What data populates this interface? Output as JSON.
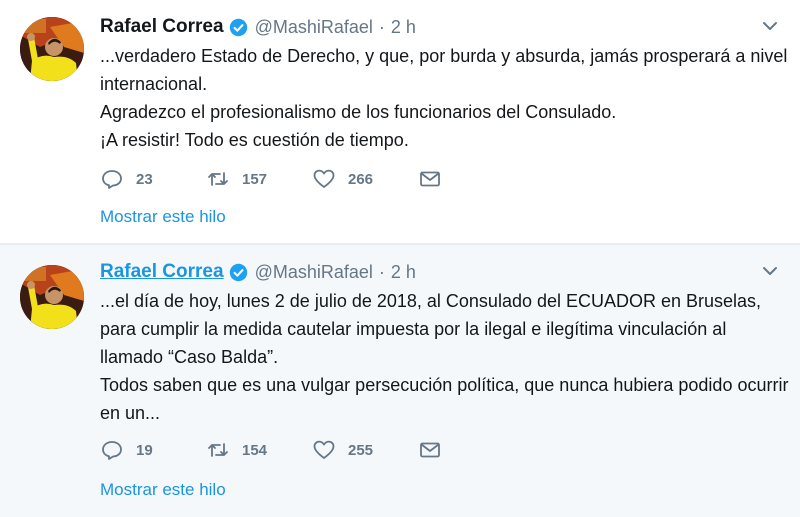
{
  "colors": {
    "link": "#1b95e0",
    "muted": "#657786",
    "text": "#14171a",
    "verified": "#1da1f2",
    "hover_bg": "#f5f8fa"
  },
  "icons": {
    "verified": "verified-badge-icon",
    "reply": "reply-icon",
    "retweet": "retweet-icon",
    "like": "heart-icon",
    "dm": "envelope-icon",
    "more": "chevron-down-icon"
  },
  "tweets": [
    {
      "name": "Rafael Correa",
      "handle": "@MashiRafael",
      "separator": "·",
      "time": "2 h",
      "text": "...verdadero Estado de Derecho, y que, por burda y absurda, jamás prosperará a nivel internacional.\nAgradezco el profesionalismo de los funcionarios del Consulado.\n¡A resistir! Todo es cuestión de tiempo.",
      "replies": "23",
      "retweets": "157",
      "likes": "266",
      "thread_link": "Mostrar este hilo"
    },
    {
      "name": "Rafael Correa",
      "handle": "@MashiRafael",
      "separator": "·",
      "time": "2 h",
      "text": "...el día de hoy, lunes 2 de julio de 2018, al Consulado del ECUADOR en Bruselas, para cumplir la medida cautelar impuesta por la ilegal e ilegítima vinculación al llamado “Caso Balda”.\nTodos saben que es una vulgar persecución política, que nunca hubiera podido ocurrir en un...",
      "replies": "19",
      "retweets": "154",
      "likes": "255",
      "thread_link": "Mostrar este hilo"
    }
  ]
}
